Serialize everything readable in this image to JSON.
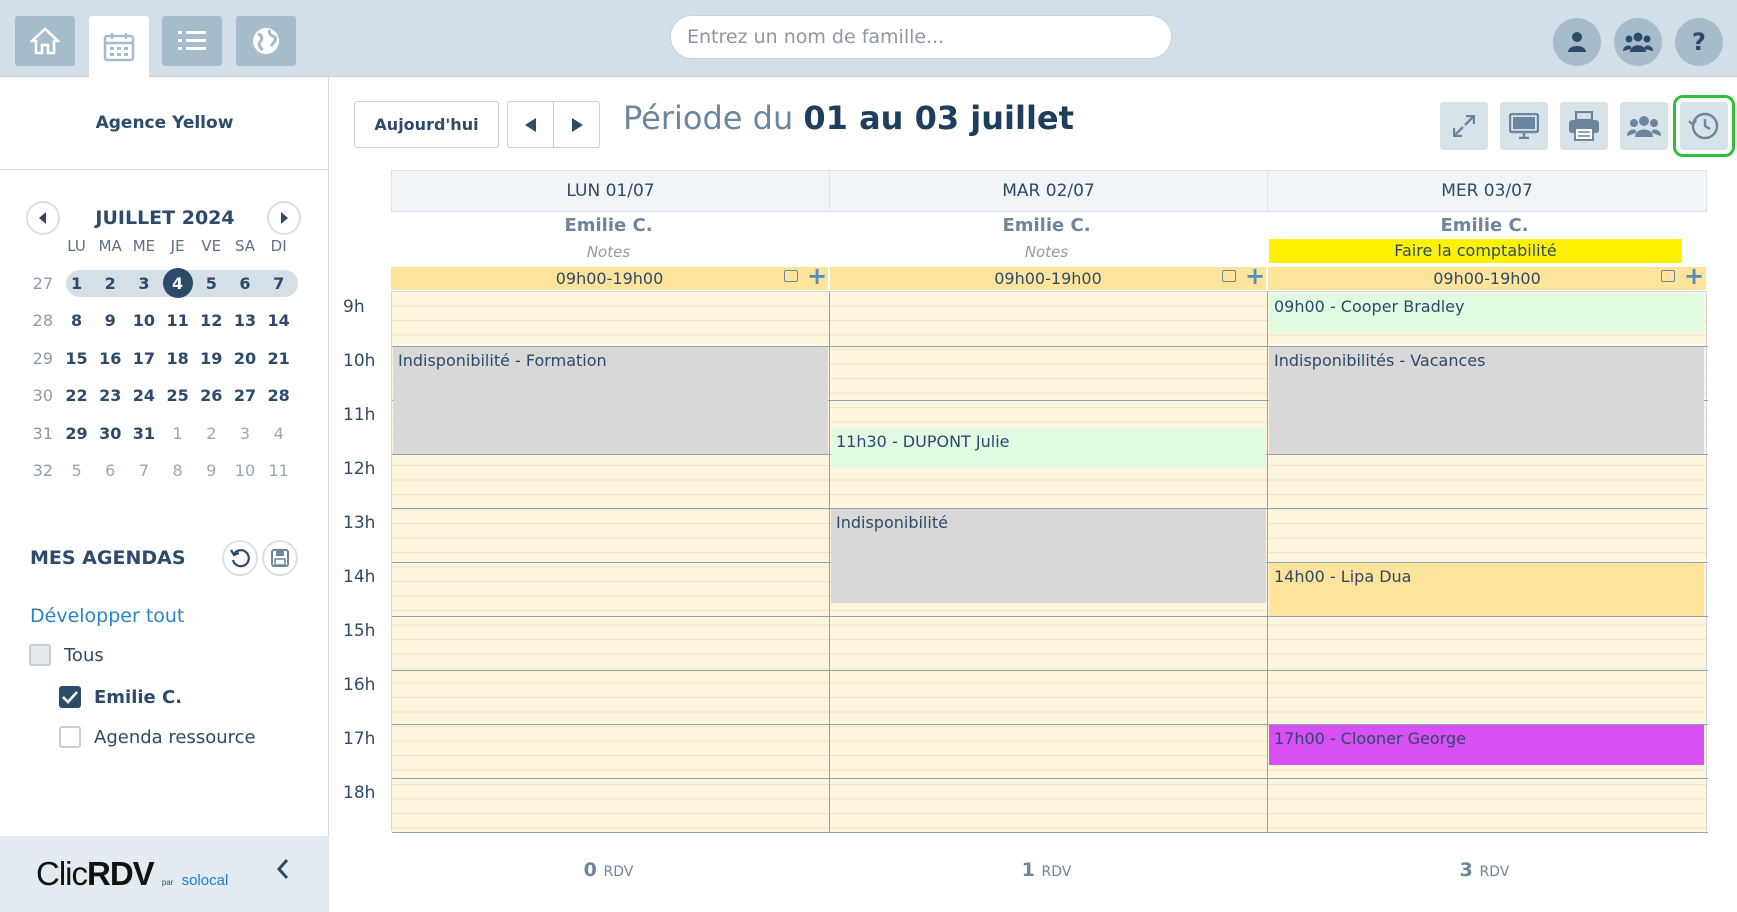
{
  "topbar": {
    "search_placeholder": "Entrez un nom de famille...",
    "nav_icons": [
      "home-icon",
      "calendar-icon",
      "list-icon",
      "globe-icon"
    ],
    "right_icons": [
      "user-icon",
      "group-icon",
      "help-icon"
    ],
    "help_label": "?"
  },
  "sidebar": {
    "agency": "Agence Yellow",
    "month_title": "JUILLET 2024",
    "weekdays": [
      "LU",
      "MA",
      "ME",
      "JE",
      "VE",
      "SA",
      "DI"
    ],
    "weeks": [
      {
        "wk": "27",
        "days": [
          "1",
          "2",
          "3",
          "4",
          "5",
          "6",
          "7"
        ]
      },
      {
        "wk": "28",
        "days": [
          "8",
          "9",
          "10",
          "11",
          "12",
          "13",
          "14"
        ]
      },
      {
        "wk": "29",
        "days": [
          "15",
          "16",
          "17",
          "18",
          "19",
          "20",
          "21"
        ]
      },
      {
        "wk": "30",
        "days": [
          "22",
          "23",
          "24",
          "25",
          "26",
          "27",
          "28"
        ]
      },
      {
        "wk": "31",
        "days": [
          "29",
          "30",
          "31",
          "1",
          "2",
          "3",
          "4"
        ]
      },
      {
        "wk": "32",
        "days": [
          "5",
          "6",
          "7",
          "8",
          "9",
          "10",
          "11"
        ]
      }
    ],
    "today": "4",
    "mes_agendas": "MES AGENDAS",
    "developper_tout": "Développer tout",
    "checkboxes": [
      {
        "label": "Tous",
        "checked": false
      },
      {
        "label": "Emilie C.",
        "checked": true
      },
      {
        "label": "Agenda ressource",
        "checked": false
      }
    ],
    "logo_main": "Clic",
    "logo_bold": "RDV",
    "logo_par": "par",
    "logo_brand": "solocal"
  },
  "toolbar": {
    "today_label": "Aujourd'hui",
    "period_prefix": "Période du ",
    "period_range": "01 au 03 juillet",
    "tool_icons": [
      "expand-icon",
      "monitor-icon",
      "printer-icon",
      "group-icon",
      "history-icon"
    ]
  },
  "days": [
    {
      "header": "LUN 01/07",
      "agent": "Emilie C.",
      "note": "Notes",
      "note_highlight": false,
      "hours": "09h00-19h00",
      "rdv_count": "0",
      "rdv_unit": "RDV"
    },
    {
      "header": "MAR 02/07",
      "agent": "Emilie C.",
      "note": "Notes",
      "note_highlight": false,
      "hours": "09h00-19h00",
      "rdv_count": "1",
      "rdv_unit": "RDV"
    },
    {
      "header": "MER 03/07",
      "agent": "Emilie C.",
      "note": "Faire la comptabilité",
      "note_highlight": true,
      "hours": "09h00-19h00",
      "rdv_count": "3",
      "rdv_unit": "RDV"
    }
  ],
  "hour_labels": [
    "9h",
    "10h",
    "11h",
    "12h",
    "13h",
    "14h",
    "15h",
    "16h",
    "17h",
    "18h"
  ],
  "events": [
    {
      "day": 0,
      "start": 10,
      "end": 12,
      "label": "Indisponibilité - Formation",
      "kind": "grey"
    },
    {
      "day": 1,
      "start": 11.5,
      "end": 12.25,
      "label": "11h30 - DUPONT Julie",
      "kind": "green"
    },
    {
      "day": 1,
      "start": 13,
      "end": 14.75,
      "label": "Indisponibilité",
      "kind": "grey"
    },
    {
      "day": 2,
      "start": 9,
      "end": 9.75,
      "label": "09h00 - Cooper Bradley",
      "kind": "green"
    },
    {
      "day": 2,
      "start": 10,
      "end": 12,
      "label": "Indisponibilités - Vacances",
      "kind": "grey"
    },
    {
      "day": 2,
      "start": 14,
      "end": 15,
      "label": "14h00 - Lipa Dua",
      "kind": "yellow"
    },
    {
      "day": 2,
      "start": 17,
      "end": 17.75,
      "label": "17h00 - Clooner George",
      "kind": "purple"
    }
  ],
  "colors": {
    "accent": "#2d4a6b",
    "highlight_green": "#2fbf3a",
    "event_purple": "#d84ff4",
    "event_green": "#e1fbe2",
    "event_yellow": "#fde49a",
    "event_grey": "#d8d8d8"
  }
}
